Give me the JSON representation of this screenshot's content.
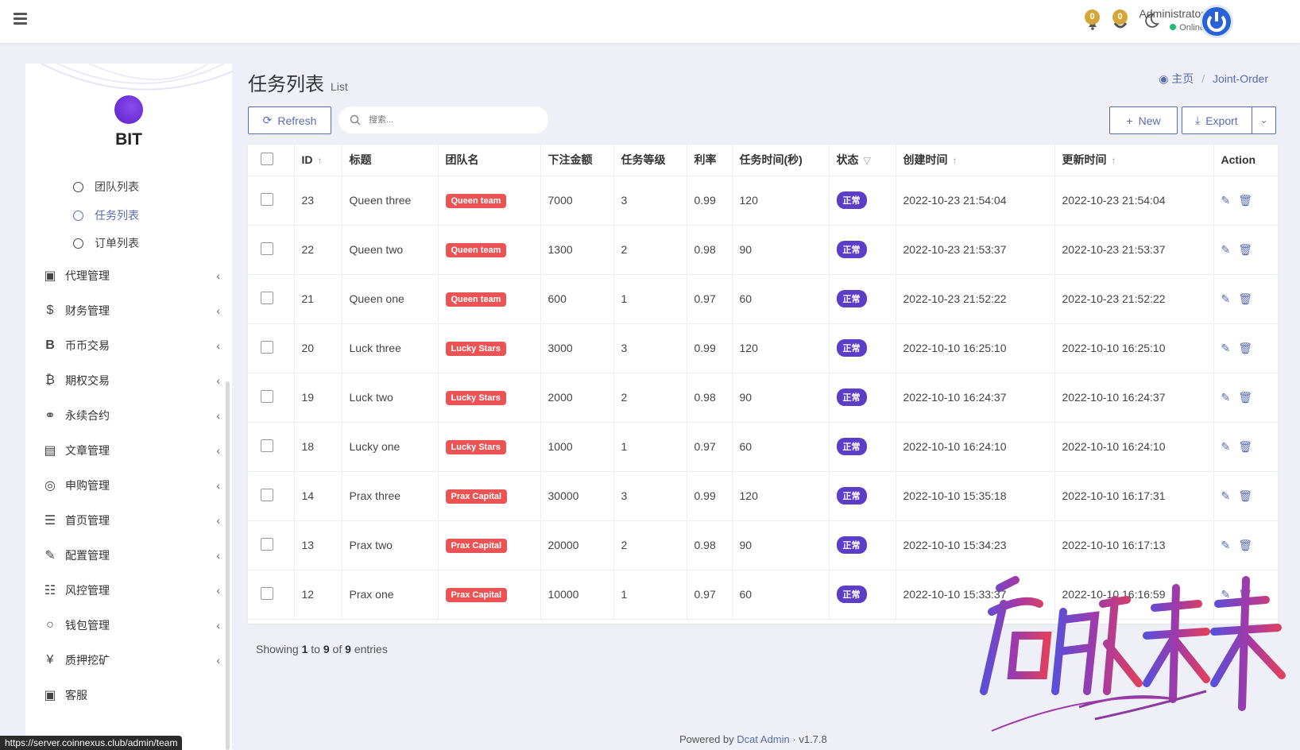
{
  "topbar": {
    "badge1": "0",
    "badge2": "0",
    "admin_name": "Administrator",
    "admin_status": "Online"
  },
  "sidebar": {
    "logo_text": "BIT",
    "sub_items": [
      "团队列表",
      "任务列表",
      "订单列表"
    ],
    "active_sub": "任务列表",
    "menu": [
      "代理管理",
      "财务管理",
      "币币交易",
      "期权交易",
      "永续合约",
      "文章管理",
      "申购管理",
      "首页管理",
      "配置管理",
      "风控管理",
      "钱包管理",
      "质押挖矿",
      "客服"
    ]
  },
  "status_url": "https://server.coinnexus.club/admin/team",
  "page": {
    "title": "任务列表",
    "subtitle": "List",
    "breadcrumb_home": "主页",
    "breadcrumb_current": "Joint-Order"
  },
  "toolbar": {
    "refresh": "Refresh",
    "search_placeholder": "搜索...",
    "new": "New",
    "export": "Export"
  },
  "table": {
    "headers": [
      "ID",
      "标题",
      "团队名",
      "下注金额",
      "任务等级",
      "利率",
      "任务时间(秒)",
      "状态",
      "创建时间",
      "更新时间",
      "Action"
    ],
    "rows": [
      {
        "id": "23",
        "title": "Queen three",
        "team": "Queen team",
        "amount": "7000",
        "level": "3",
        "rate": "0.99",
        "time": "120",
        "status": "正常",
        "created": "2022-10-23 21:54:04",
        "updated": "2022-10-23 21:54:04"
      },
      {
        "id": "22",
        "title": "Queen two",
        "team": "Queen team",
        "amount": "1300",
        "level": "2",
        "rate": "0.98",
        "time": "90",
        "status": "正常",
        "created": "2022-10-23 21:53:37",
        "updated": "2022-10-23 21:53:37"
      },
      {
        "id": "21",
        "title": "Queen one",
        "team": "Queen team",
        "amount": "600",
        "level": "1",
        "rate": "0.97",
        "time": "60",
        "status": "正常",
        "created": "2022-10-23 21:52:22",
        "updated": "2022-10-23 21:52:22"
      },
      {
        "id": "20",
        "title": "Luck three",
        "team": "Lucky Stars",
        "amount": "3000",
        "level": "3",
        "rate": "0.99",
        "time": "120",
        "status": "正常",
        "created": "2022-10-10 16:25:10",
        "updated": "2022-10-10 16:25:10"
      },
      {
        "id": "19",
        "title": "Luck two",
        "team": "Lucky Stars",
        "amount": "2000",
        "level": "2",
        "rate": "0.98",
        "time": "90",
        "status": "正常",
        "created": "2022-10-10 16:24:37",
        "updated": "2022-10-10 16:24:37"
      },
      {
        "id": "18",
        "title": "Lucky one",
        "team": "Lucky Stars",
        "amount": "1000",
        "level": "1",
        "rate": "0.97",
        "time": "60",
        "status": "正常",
        "created": "2022-10-10 16:24:10",
        "updated": "2022-10-10 16:24:10"
      },
      {
        "id": "14",
        "title": "Prax three",
        "team": "Prax Capital",
        "amount": "30000",
        "level": "3",
        "rate": "0.99",
        "time": "120",
        "status": "正常",
        "created": "2022-10-10 15:35:18",
        "updated": "2022-10-10 16:17:31"
      },
      {
        "id": "13",
        "title": "Prax two",
        "team": "Prax Capital",
        "amount": "20000",
        "level": "2",
        "rate": "0.98",
        "time": "90",
        "status": "正常",
        "created": "2022-10-10 15:34:23",
        "updated": "2022-10-10 16:17:13"
      },
      {
        "id": "12",
        "title": "Prax one",
        "team": "Prax Capital",
        "amount": "10000",
        "level": "1",
        "rate": "0.97",
        "time": "60",
        "status": "正常",
        "created": "2022-10-10 15:33:37",
        "updated": "2022-10-10 16:16:59"
      }
    ]
  },
  "pagination": {
    "prefix": "Showing",
    "from": "1",
    "to_word": "to",
    "to": "9",
    "of_word": "of",
    "total": "9",
    "suffix": "entries"
  },
  "footer": {
    "prefix": "Powered by",
    "link": "Dcat Admin",
    "version": "v1.7.8"
  },
  "watermark_text": "启航未来 2024加油!",
  "colors": {
    "accent": "#586cb1",
    "team_badge": "#ea5455",
    "status_badge": "#5b3dc9",
    "badge_gold": "#d4a537"
  }
}
